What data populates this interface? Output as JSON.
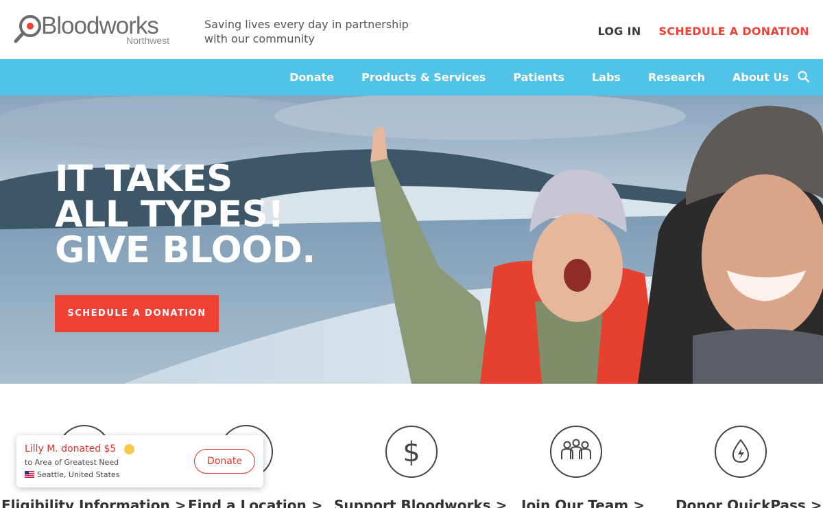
{
  "header": {
    "logo": {
      "name": "Bloodworks",
      "sub": "Northwest"
    },
    "tagline": "Saving lives every day in partnership with our community",
    "login_label": "LOG IN",
    "schedule_label": "SCHEDULE A DONATION"
  },
  "nav": {
    "items": [
      {
        "label": "Donate"
      },
      {
        "label": "Products & Services"
      },
      {
        "label": "Patients"
      },
      {
        "label": "Labs"
      },
      {
        "label": "Research"
      },
      {
        "label": "About Us"
      }
    ],
    "search_icon": "search-icon"
  },
  "hero": {
    "title_lines": [
      "IT TAKES",
      "ALL TYPES!",
      "GIVE BLOOD."
    ],
    "button_label": "SCHEDULE A DONATION"
  },
  "quick_links": [
    {
      "label": "Eligibility Information >",
      "icon": "info-icon"
    },
    {
      "label": "Find a Location >",
      "icon": "location-icon"
    },
    {
      "label": "Support Bloodworks >",
      "icon": "dollar-icon"
    },
    {
      "label": "Join Our Team >",
      "icon": "team-icon"
    },
    {
      "label": "Donor QuickPass >",
      "icon": "quickpass-drop-icon"
    }
  ],
  "donation_popup": {
    "name_text": "Lilly M. donated $5",
    "to_text": "to Area of Greatest Need",
    "location_text": "Seattle, United States",
    "button_label": "Donate"
  },
  "colors": {
    "brand_red": "#ef4136",
    "nav_blue": "#52c3e8",
    "text_gray": "#555555"
  }
}
